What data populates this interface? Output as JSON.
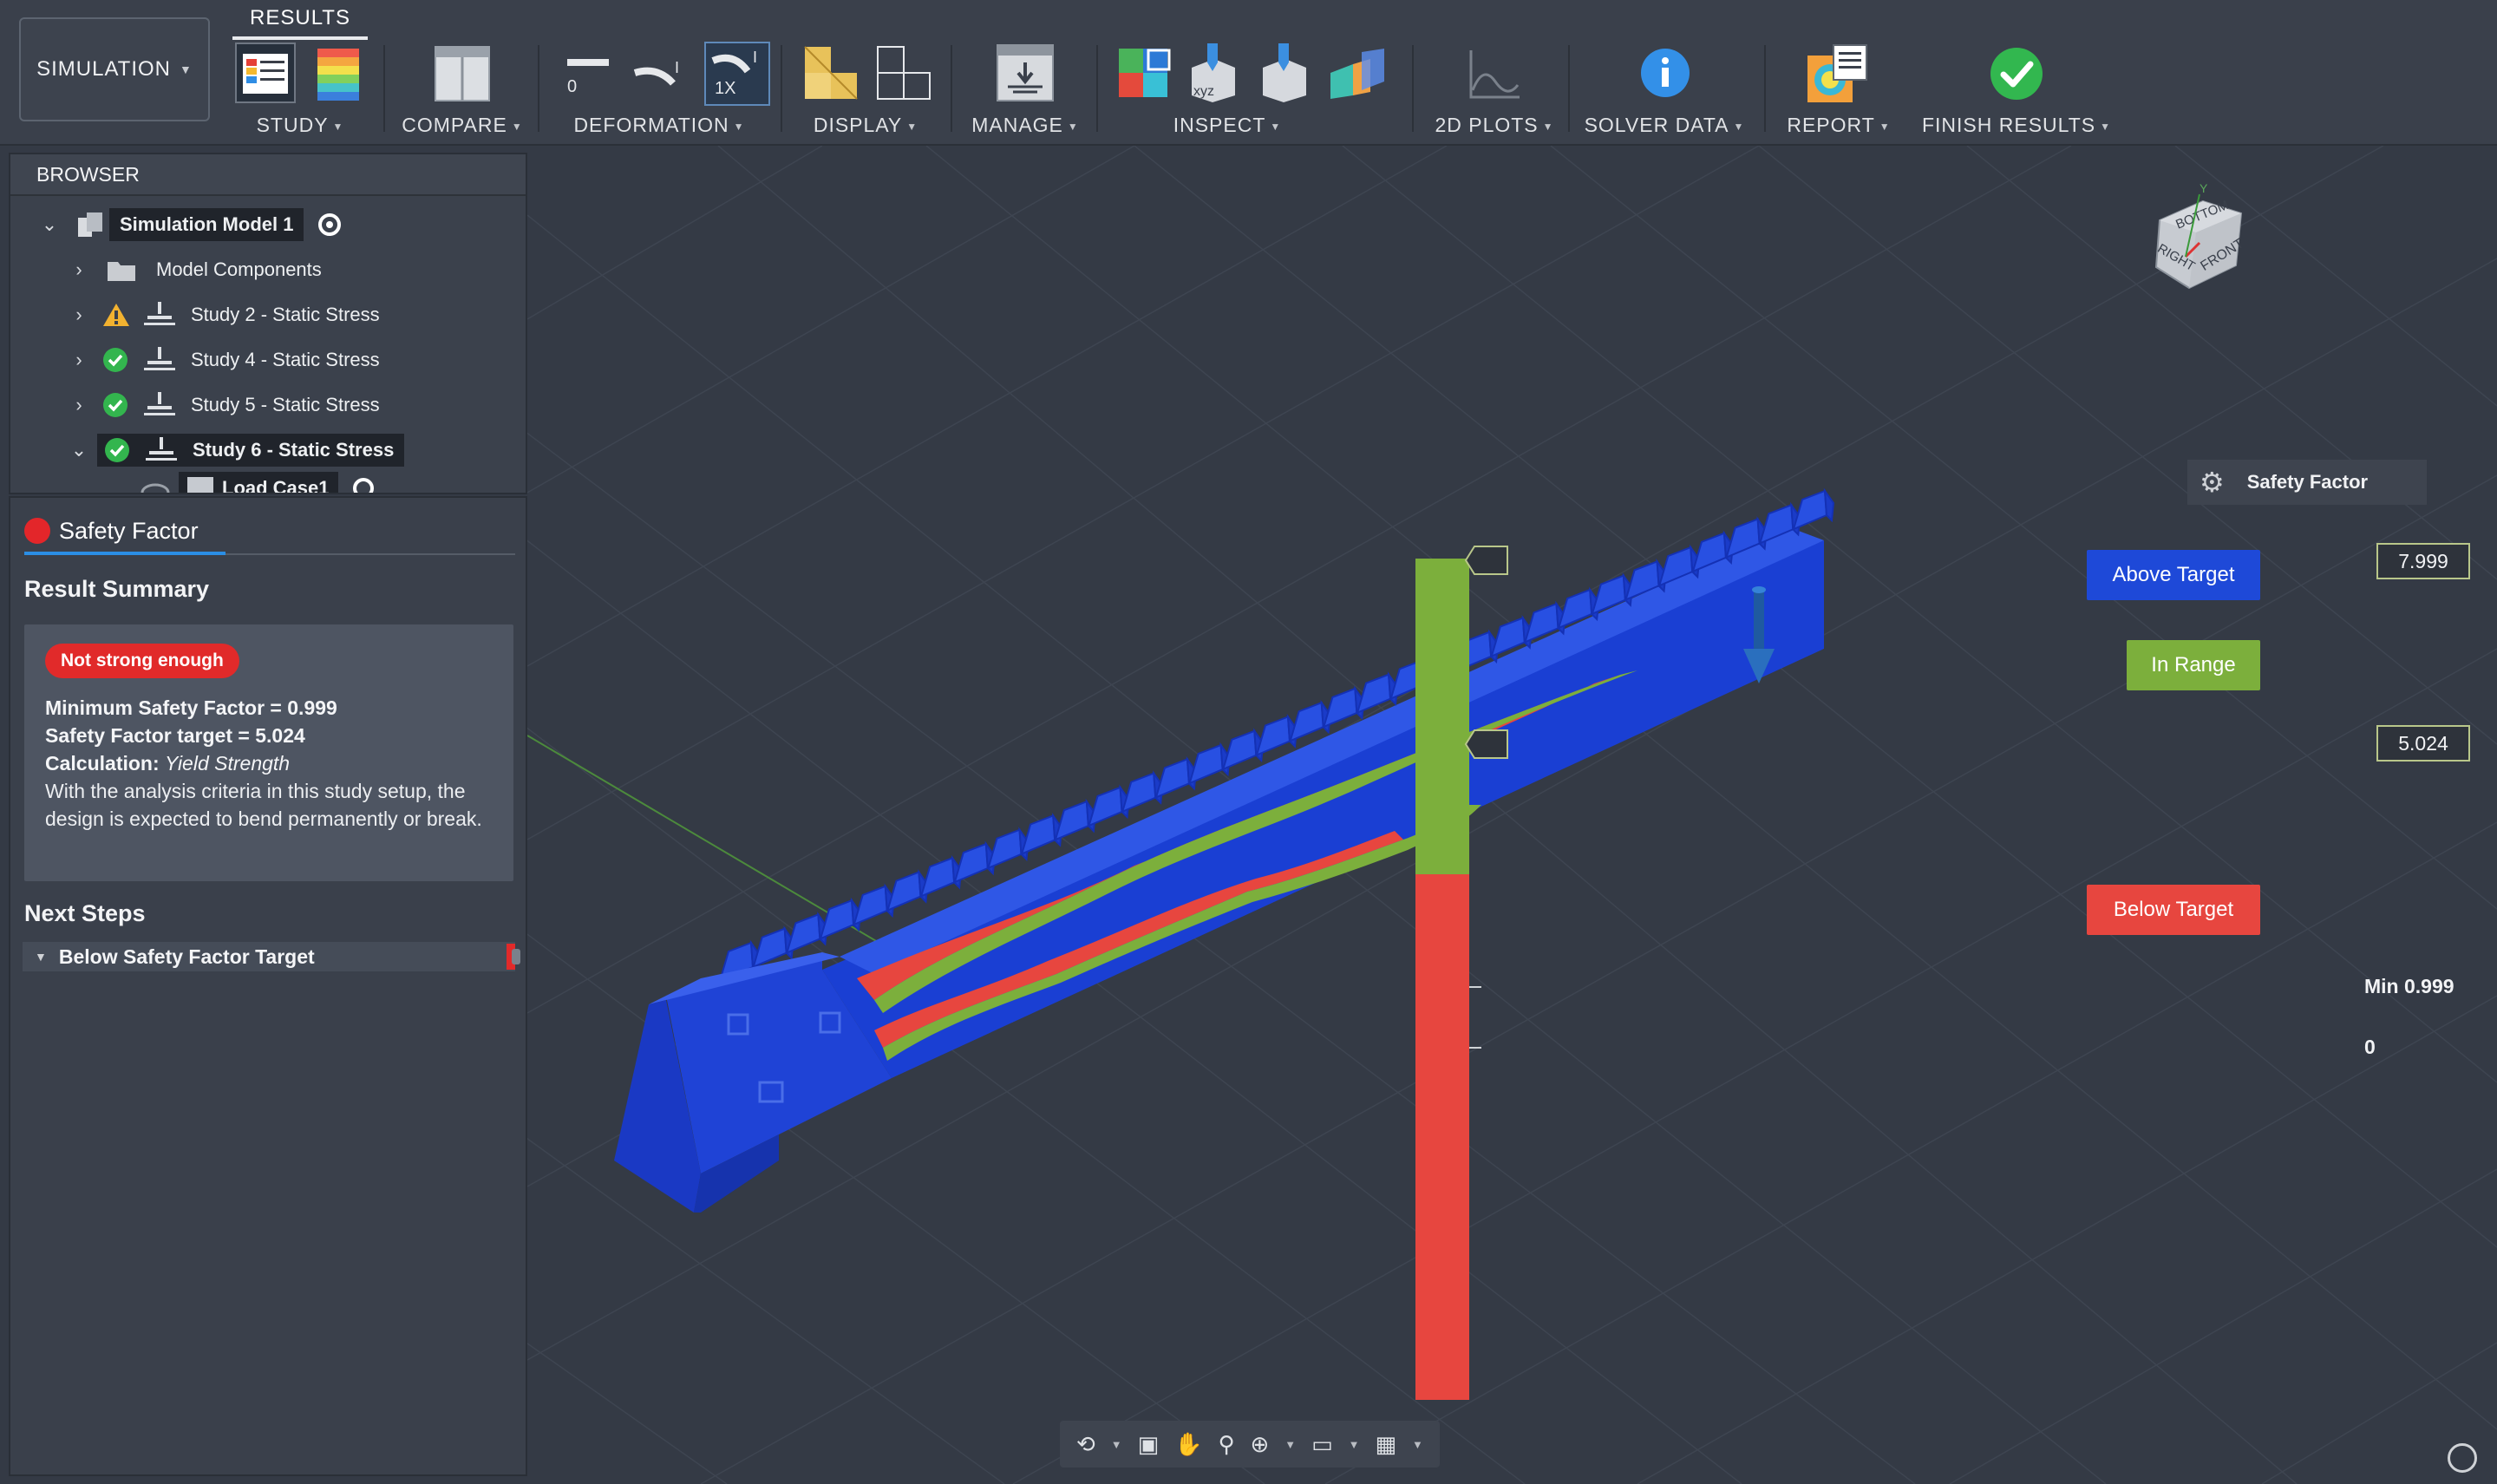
{
  "toolbar": {
    "workspace": "SIMULATION",
    "active_tab": "RESULTS",
    "groups": {
      "study": "STUDY",
      "compare": "COMPARE",
      "deformation": "DEFORMATION",
      "display": "DISPLAY",
      "manage": "MANAGE",
      "inspect": "INSPECT",
      "plots_2d": "2D PLOTS",
      "solver_data": "SOLVER DATA",
      "report": "REPORT",
      "finish_results": "FINISH RESULTS"
    },
    "deformation_zero_label": "0",
    "deformation_1x_label": "1X",
    "inspect_xyz_label": "xyz"
  },
  "browser": {
    "title": "BROWSER",
    "root": "Simulation Model 1",
    "items": [
      {
        "label": "Model Components",
        "status": "folder"
      },
      {
        "label": "Study 2 - Static Stress",
        "status": "warning"
      },
      {
        "label": "Study 4 - Static Stress",
        "status": "ok"
      },
      {
        "label": "Study 5 - Static Stress",
        "status": "ok"
      },
      {
        "label": "Study 6 - Static Stress",
        "status": "ok"
      }
    ],
    "child_partial": "Load Case1"
  },
  "safety_panel": {
    "title": "Safety Factor",
    "summary_heading": "Result Summary",
    "badge": "Not strong enough",
    "min_sf_label": "Minimum Safety Factor = 0.999",
    "target_label": "Safety Factor target = 5.024",
    "calc_label": "Calculation:",
    "calc_value": "Yield Strength",
    "description": "With the analysis criteria in this study setup, the design is expected to bend permanently or break.",
    "next_steps_heading": "Next Steps",
    "next_steps_item": "Below Safety Factor Target"
  },
  "legend": {
    "title": "Safety Factor",
    "above": "Above Target",
    "in_range": "In Range",
    "below": "Below Target",
    "max_value": "7.999",
    "target_value": "5.024",
    "min_label": "Min 0.999",
    "zero_label": "0",
    "colors": {
      "above": "#1e49d8",
      "in_range": "#7caf3c",
      "below": "#e7463f"
    }
  },
  "viewcube": {
    "faces": [
      "BOTTOM",
      "FRONT",
      "RIGHT"
    ],
    "axis_y": "Y"
  }
}
